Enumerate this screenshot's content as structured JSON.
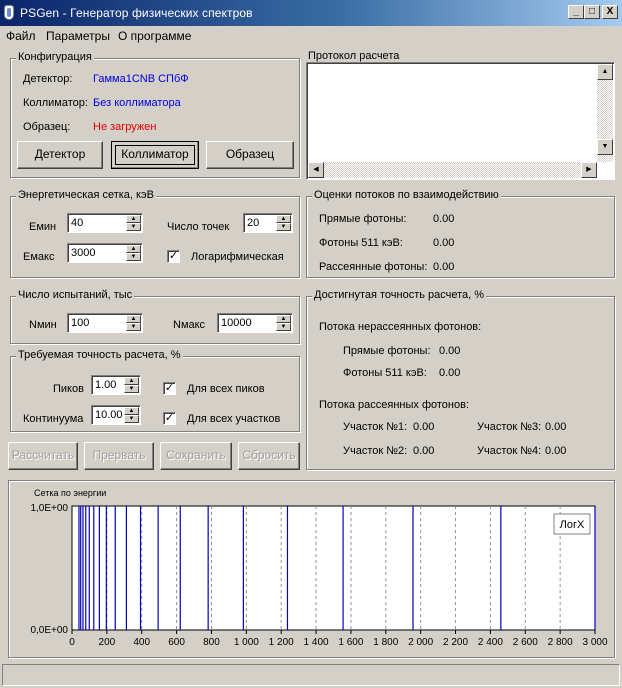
{
  "window": {
    "title": "PSGen - Генератор физических спектров",
    "btn_min": "_",
    "btn_max": "□",
    "btn_close": "X"
  },
  "menu": [
    "Файл",
    "Параметры",
    "О программе"
  ],
  "config": {
    "legend": "Конфигурация",
    "detector_label": "Детектор:",
    "detector_value": "Гамма1CNB СПбФ",
    "collimator_label": "Коллиматор:",
    "collimator_value": "Без коллиматора",
    "sample_label": "Образец:",
    "sample_value": "Не загружен",
    "btn_detector": "Детектор",
    "btn_collimator": "Коллиматор",
    "btn_sample": "Образец"
  },
  "protocol": {
    "legend": "Протокол расчета"
  },
  "energy": {
    "legend": "Энергетическая сетка, кэВ",
    "emin_label": "Емин",
    "emin_value": "40",
    "emax_label": "Емакс",
    "emax_value": "3000",
    "points_label": "Число точек",
    "points_value": "20",
    "log_label": "Логарифмическая",
    "log_checked": "✓"
  },
  "flux": {
    "legend": "Оценки потоков по взаимодействию",
    "direct_label": "Прямые фотоны:",
    "direct_value": "0.00",
    "f511_label": "Фотоны 511 кэВ:",
    "f511_value": "0.00",
    "scatter_label": "Рассеянные фотоны:",
    "scatter_value": "0.00"
  },
  "trials": {
    "legend": "Число испытаний, тыс",
    "nmin_label": "Nмин",
    "nmin_value": "100",
    "nmax_label": "Nмакс",
    "nmax_value": "10000"
  },
  "precision": {
    "legend": "Требуемая точность расчета, %",
    "peaks_label": "Пиков",
    "peaks_value": "1.00",
    "cont_label": "Континуума",
    "cont_value": "10.00",
    "all_peaks_label": "Для всех пиков",
    "all_peaks_checked": "✓",
    "all_parts_label": "Для всех участков",
    "all_parts_checked": "✓"
  },
  "achieved": {
    "legend": "Достигнутая точность расчета, %",
    "unscattered_header": "Потока нерассеянных фотонов:",
    "direct_label": "Прямые фотоны:",
    "direct_value": "0.00",
    "f511_label": "Фотоны 511 кэВ:",
    "f511_value": "0.00",
    "scattered_header": "Потока рассеянных фотонов:",
    "part1_label": "Участок №1:",
    "part1_value": "0.00",
    "part2_label": "Участок №2:",
    "part2_value": "0.00",
    "part3_label": "Участок №3:",
    "part3_value": "0.00",
    "part4_label": "Участок №4:",
    "part4_value": "0.00"
  },
  "actions": {
    "calc": "Рассчитать",
    "stop": "Прервать",
    "save": "Сохранить",
    "reset": "Сбросить"
  },
  "chart_data": {
    "type": "line",
    "title": "Сетка по энергии",
    "y_tick_labels": [
      "1,0E+00",
      "0,0E+00"
    ],
    "x_ticks": [
      0,
      200,
      400,
      600,
      800,
      1000,
      1200,
      1400,
      1600,
      1800,
      2000,
      2200,
      2400,
      2600,
      2800,
      3000
    ],
    "x_tick_labels": [
      "0",
      "200",
      "400",
      "600",
      "800",
      "1 000",
      "1 200",
      "1 400",
      "1 600",
      "1 800",
      "2 000",
      "2 200",
      "2 400",
      "2 600",
      "2 800",
      "3 000"
    ],
    "xlim": [
      0,
      3000
    ],
    "ylim": [
      0,
      1
    ],
    "grid_lines": [
      40,
      50,
      63,
      79,
      99,
      125,
      157,
      197,
      248,
      312,
      393,
      494,
      621,
      781,
      983,
      1236,
      1555,
      1956,
      2460,
      3000
    ],
    "button_label": "ЛогX",
    "line_color": "#0000c0"
  }
}
